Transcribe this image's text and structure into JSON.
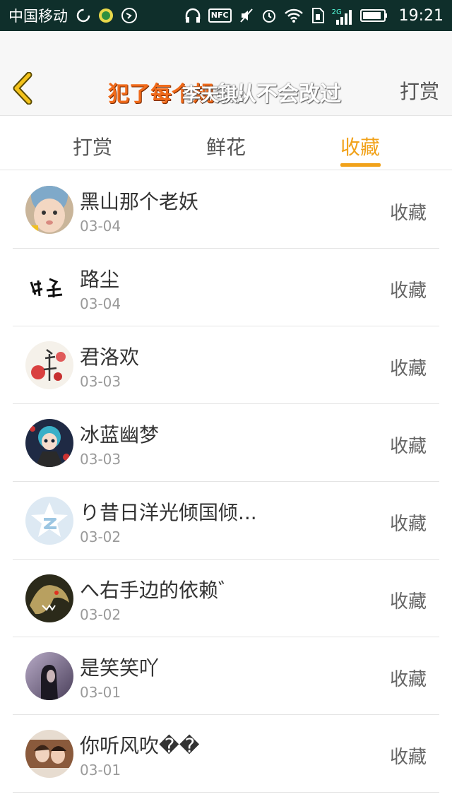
{
  "status_bar": {
    "carrier": "中国移动",
    "time": "19:21",
    "network": "2G",
    "nfc": "NFC",
    "icons": [
      "sync-icon",
      "green-circle-icon",
      "headset-icon",
      "headphones-icon",
      "nfc-icon",
      "mute-icon",
      "alarm-icon",
      "wifi-icon",
      "sim-icon",
      "signal-icon",
      "battery-icon"
    ]
  },
  "header": {
    "back_icon": "chevron-left-icon",
    "title_part1": "犯了每个规",
    "title_part2": "条从不会改过",
    "subtitle": "李天琪:",
    "right_label": "打赏"
  },
  "tabs": [
    {
      "label": "打赏",
      "active": false
    },
    {
      "label": "鲜花",
      "active": false
    },
    {
      "label": "收藏",
      "active": true
    }
  ],
  "colors": {
    "accent": "#f1a21a",
    "title_orange": "#f06a1a",
    "status_bar": "#0f2f2b"
  },
  "items": [
    {
      "name": "黑山那个老妖",
      "date": "03-04",
      "action": "收藏",
      "avatar": "baby-photo"
    },
    {
      "name": "路尘",
      "date": "03-04",
      "action": "收藏",
      "avatar": "calligraphy"
    },
    {
      "name": "君洛欢",
      "date": "03-03",
      "action": "收藏",
      "avatar": "red-flower-calligraphy"
    },
    {
      "name": "冰蓝幽梦",
      "date": "03-03",
      "action": "收藏",
      "avatar": "anime-character"
    },
    {
      "name": "り昔日洋光倾国倾...",
      "date": "03-02",
      "action": "收藏",
      "avatar": "qzone-star"
    },
    {
      "name": "へ右手边的依赖゛",
      "date": "03-02",
      "action": "收藏",
      "avatar": "dragon"
    },
    {
      "name": "是笑笑吖",
      "date": "03-01",
      "action": "收藏",
      "avatar": "girl-silhouette"
    },
    {
      "name": "你听风吹��",
      "date": "03-01",
      "action": "收藏",
      "avatar": "couple-photo"
    }
  ]
}
